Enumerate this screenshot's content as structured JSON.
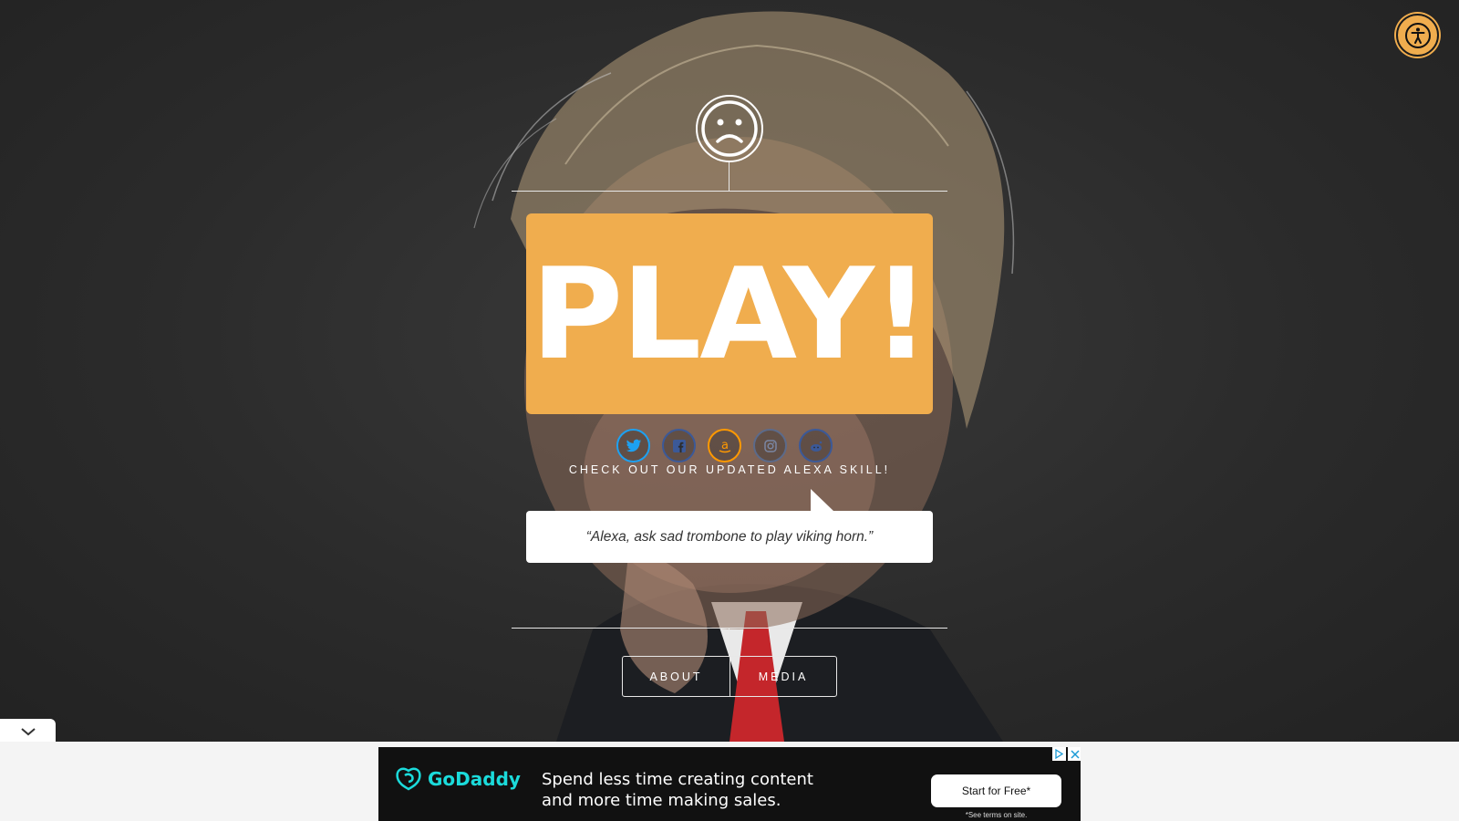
{
  "hero": {
    "play_label": "PLAY!",
    "alexa_caption": "CHECK OUT OUR UPDATED ALEXA SKILL!",
    "alexa_quote": "“Alexa, ask sad trombone to play viking horn.”"
  },
  "social": [
    {
      "name": "twitter-icon",
      "color": "#1da1f2"
    },
    {
      "name": "facebook-icon",
      "color": "#3b5998"
    },
    {
      "name": "amazon-icon",
      "color": "#ff9900"
    },
    {
      "name": "instagram-icon",
      "color": "#5b6a8a"
    },
    {
      "name": "reddit-icon",
      "color": "#3b5998"
    }
  ],
  "nav": {
    "about_label": "ABOUT",
    "media_label": "MEDIA"
  },
  "ad": {
    "brand": "GoDaddy",
    "headline": "Spend less time creating content and more time making sales.",
    "cta_label": "Start for Free*",
    "terms": "*See terms on site."
  },
  "colors": {
    "accent": "#f0ad4e",
    "background": "#2c2c2c",
    "brand_teal": "#1bdbdb"
  }
}
